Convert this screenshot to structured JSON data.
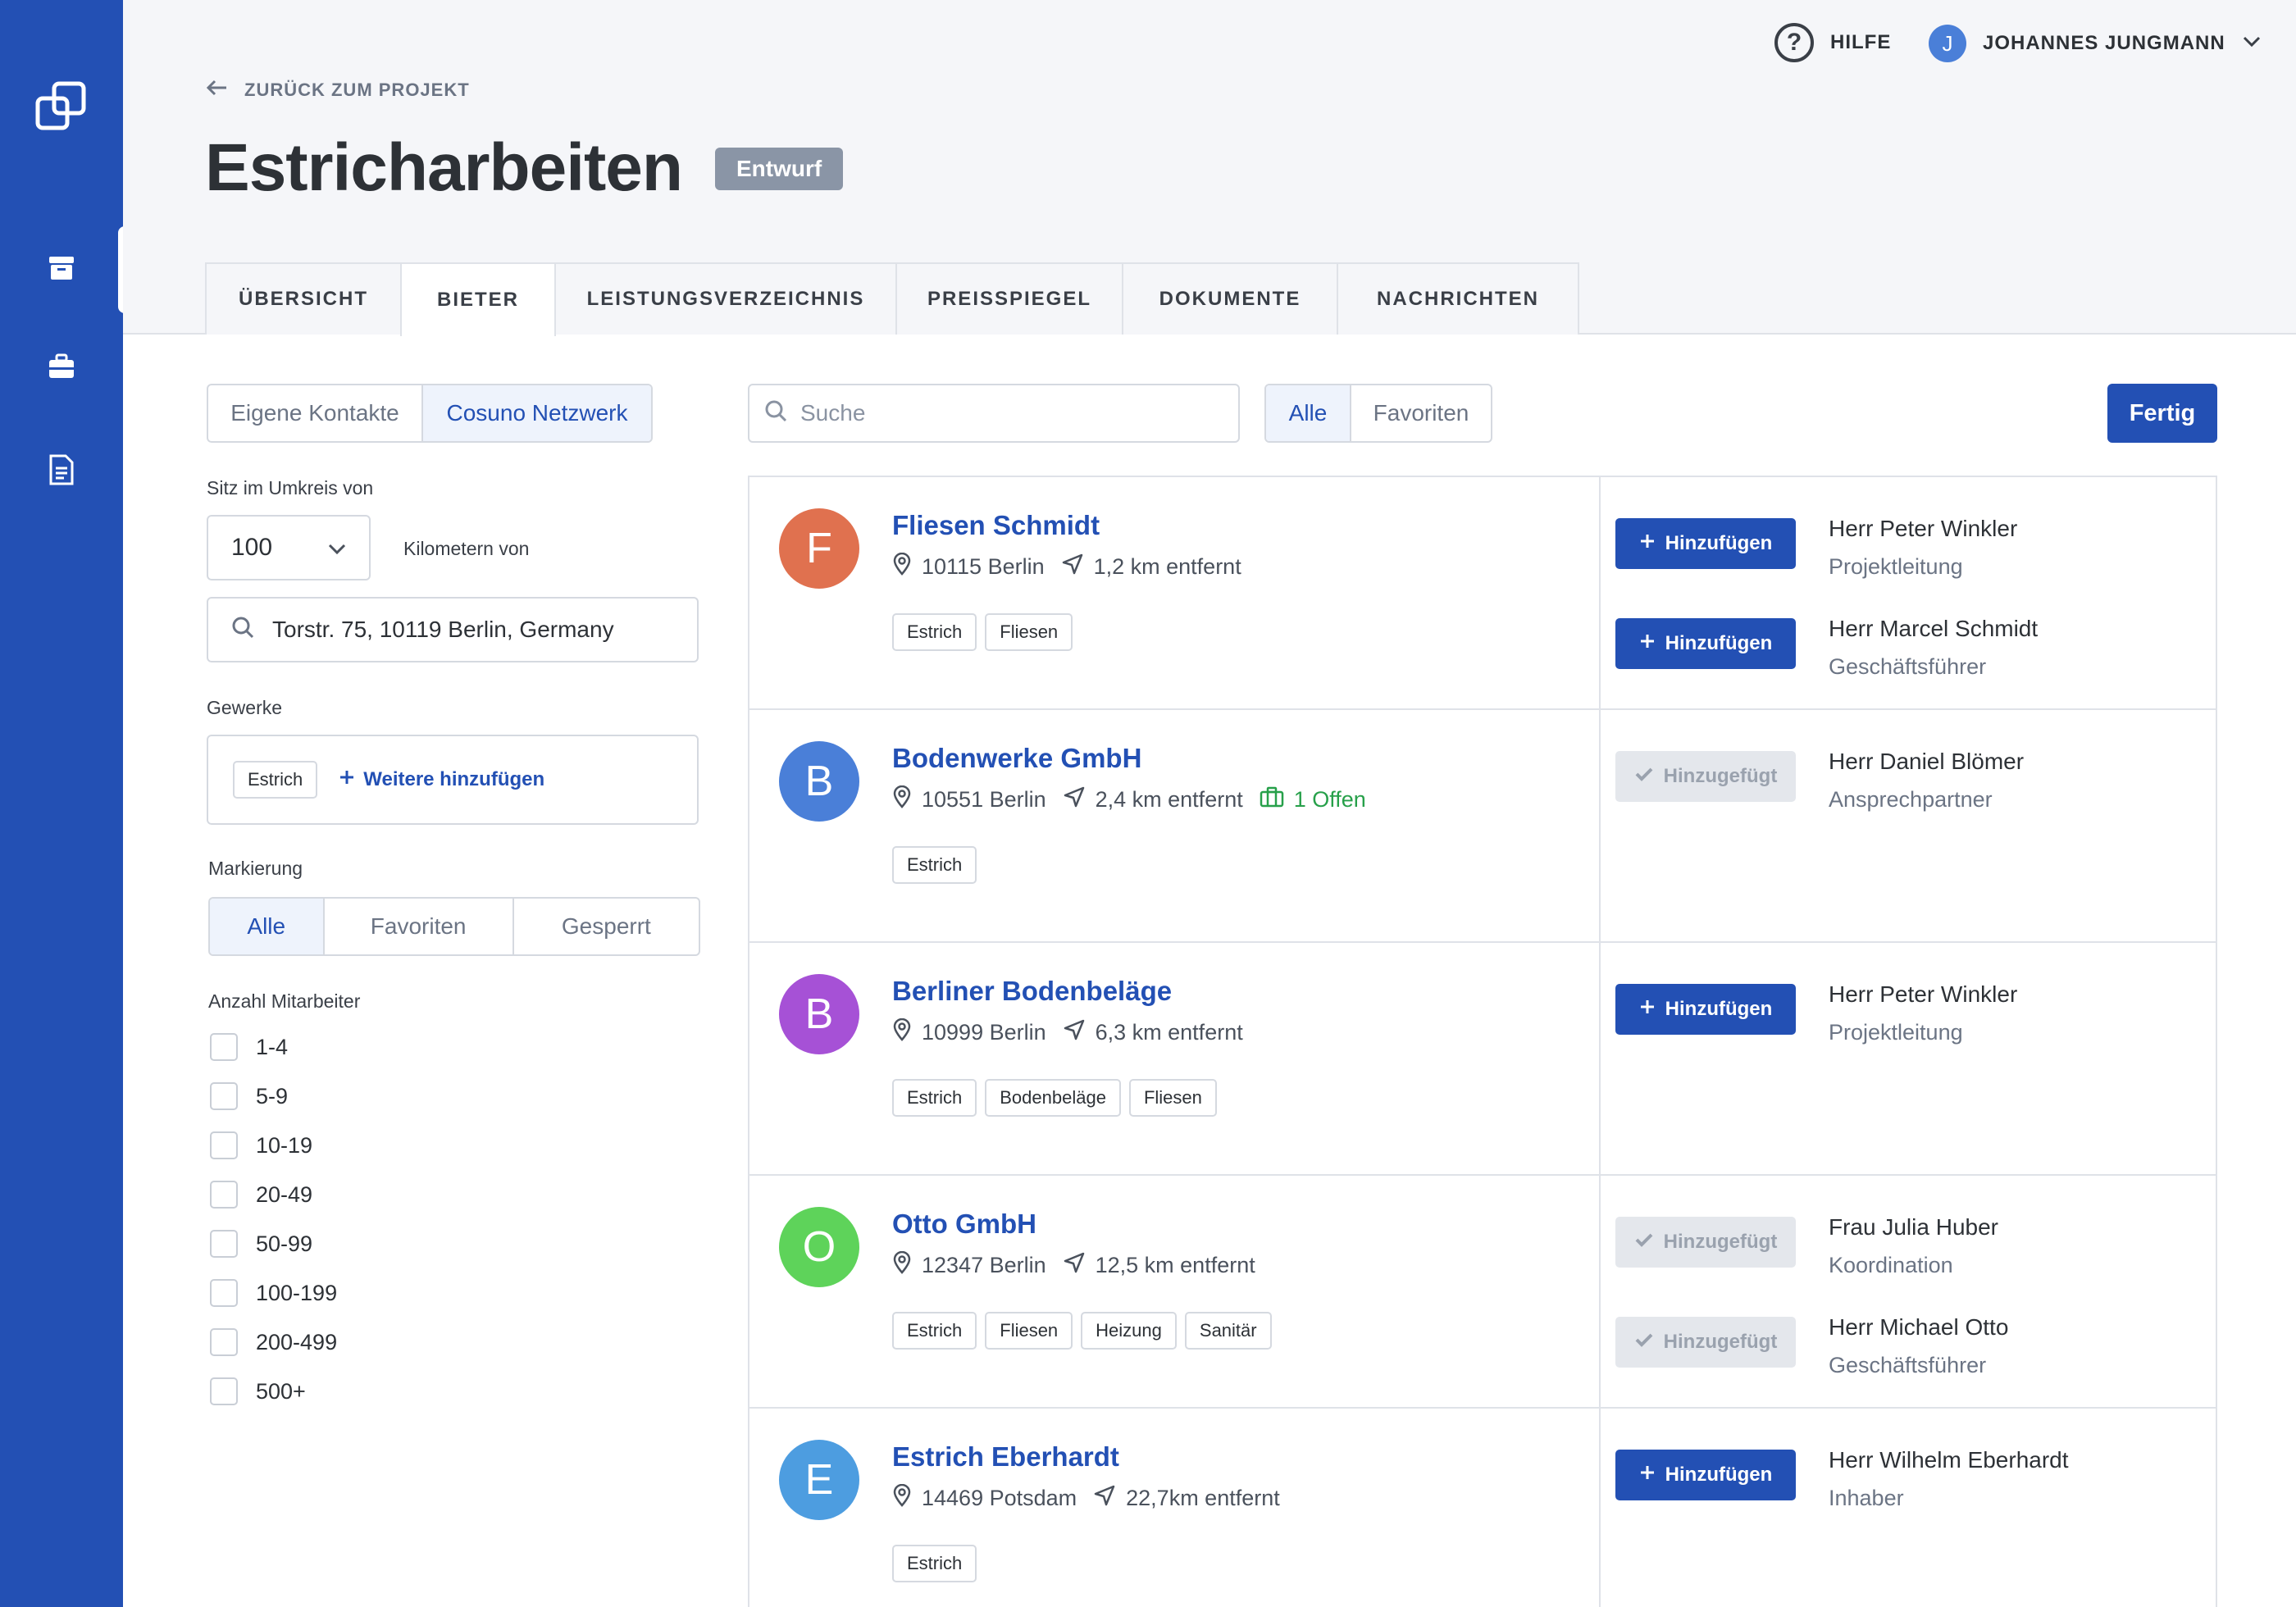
{
  "topbar": {
    "help_label": "HILFE",
    "user_initial": "J",
    "user_name": "JOHANNES JUNGMANN"
  },
  "header": {
    "back_label": "ZURÜCK ZUM PROJEKT",
    "title": "Estricharbeiten",
    "status": "Entwurf"
  },
  "tabs": [
    "ÜBERSICHT",
    "BIETER",
    "LEISTUNGSVERZEICHNIS",
    "PREISSPIEGEL",
    "DOKUMENTE",
    "NACHRICHTEN"
  ],
  "active_tab": "BIETER",
  "filters": {
    "source_options": [
      "Eigene Kontakte",
      "Cosuno Netzwerk"
    ],
    "source_selected": "Cosuno Netzwerk",
    "radius_label": "Sitz im Umkreis von",
    "radius_value": "100",
    "radius_unit_label": "Kilometern von",
    "address": "Torstr. 75, 10119 Berlin, Germany",
    "trades_label": "Gewerke",
    "trades": [
      "Estrich"
    ],
    "add_more_label": "Weitere hinzufügen",
    "marking_label": "Markierung",
    "marking_options": [
      "Alle",
      "Favoriten",
      "Gesperrt"
    ],
    "marking_selected": "Alle",
    "employees_label": "Anzahl Mitarbeiter",
    "employee_ranges": [
      "1-4",
      "5-9",
      "10-19",
      "20-49",
      "50-99",
      "100-199",
      "200-499",
      "500+"
    ]
  },
  "search": {
    "placeholder": "Suche",
    "view_options": [
      "Alle",
      "Favoriten"
    ],
    "view_selected": "Alle",
    "done_label": "Fertig"
  },
  "colors": {
    "brand": "#2350b4",
    "open_green": "#27a04a"
  },
  "companies": [
    {
      "initial": "F",
      "color": "#e0714f",
      "name": "Fliesen Schmidt",
      "city": "10115 Berlin",
      "distance": "1,2 km entfernt",
      "open": "",
      "tags": [
        "Estrich",
        "Fliesen"
      ],
      "contacts": [
        {
          "action": "Hinzufügen",
          "added": false,
          "name": "Herr Peter Winkler",
          "role": "Projektleitung"
        },
        {
          "action": "Hinzufügen",
          "added": false,
          "name": "Herr Marcel Schmidt",
          "role": "Geschäftsführer"
        }
      ]
    },
    {
      "initial": "B",
      "color": "#4a7fd8",
      "name": "Bodenwerke GmbH",
      "city": "10551 Berlin",
      "distance": "2,4 km entfernt",
      "open": "1 Offen",
      "tags": [
        "Estrich"
      ],
      "contacts": [
        {
          "action": "Hinzugefügt",
          "added": true,
          "name": "Herr Daniel Blömer",
          "role": "Ansprechpartner"
        }
      ]
    },
    {
      "initial": "B",
      "color": "#a651d6",
      "name": "Berliner Bodenbeläge",
      "city": "10999 Berlin",
      "distance": "6,3 km entfernt",
      "open": "",
      "tags": [
        "Estrich",
        "Bodenbeläge",
        "Fliesen"
      ],
      "contacts": [
        {
          "action": "Hinzufügen",
          "added": false,
          "name": "Herr Peter Winkler",
          "role": "Projektleitung"
        }
      ]
    },
    {
      "initial": "O",
      "color": "#5ed35a",
      "name": "Otto GmbH",
      "city": "12347 Berlin",
      "distance": "12,5 km entfernt",
      "open": "",
      "tags": [
        "Estrich",
        "Fliesen",
        "Heizung",
        "Sanitär"
      ],
      "contacts": [
        {
          "action": "Hinzugefügt",
          "added": true,
          "name": "Frau Julia Huber",
          "role": "Koordination"
        },
        {
          "action": "Hinzugefügt",
          "added": true,
          "name": "Herr Michael Otto",
          "role": "Geschäftsführer"
        }
      ]
    },
    {
      "initial": "E",
      "color": "#4d9de0",
      "name": "Estrich Eberhardt",
      "city": "14469 Potsdam",
      "distance": "22,7km entfernt",
      "open": "",
      "tags": [
        "Estrich"
      ],
      "contacts": [
        {
          "action": "Hinzufügen",
          "added": false,
          "name": "Herr Wilhelm Eberhardt",
          "role": "Inhaber"
        }
      ]
    }
  ]
}
